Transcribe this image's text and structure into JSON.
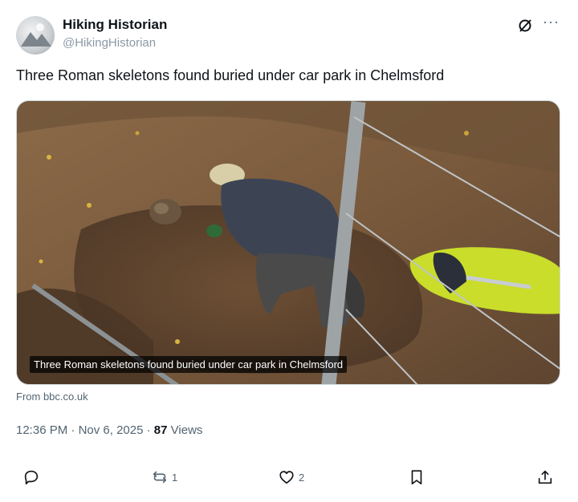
{
  "author": {
    "display_name": "Hiking Historian",
    "handle": "@HikingHistorian"
  },
  "post": {
    "text": "Three Roman skeletons found buried under car park in Chelmsford",
    "media_caption": "Three Roman skeletons found buried under car park in Chelmsford",
    "source": "From bbc.co.uk",
    "time": "12:36 PM",
    "separator": "·",
    "date": "Nov 6, 2025",
    "views_count": "87",
    "views_label": "Views"
  },
  "actions": {
    "reply_count": "",
    "repost_count": "1",
    "like_count": "2"
  },
  "icons": {
    "header": [
      "grok-icon",
      "more-icon"
    ],
    "actions": [
      "reply-icon",
      "repost-icon",
      "like-icon",
      "bookmark-icon",
      "share-icon"
    ]
  },
  "colors": {
    "text_primary": "#0f1419",
    "text_secondary": "#536471",
    "handle": "#8b98a5"
  }
}
